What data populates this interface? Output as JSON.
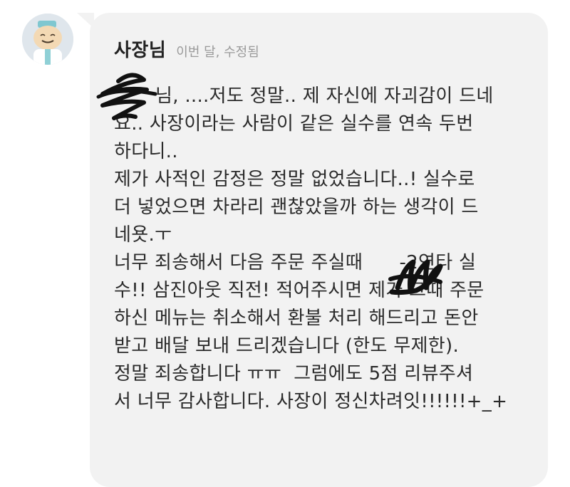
{
  "sender": {
    "name": "사장님",
    "meta": "이번 달, 수정됨"
  },
  "message": {
    "lines": [
      "님, ....저도 정말.. 제 자신에 자괴감이 드네",
      "요.. 사장이라는 사람이 같은 실수를 연속 두번",
      "하다니..",
      "제가 사적인 감정은 정말 없었습니다..! 실수로",
      "더 넣었으면 차라리 괜찮았을까 하는 생각이 드",
      "네욧.ㅜ",
      "너무 죄송해서 다음 주문 주실때      -2연타 실",
      "수!! 삼진아웃 직전! 적어주시면 제가 그때 주문",
      "하신 메뉴는 취소해서 환불 처리 해드리고 돈안",
      "받고 배달 보내 드리겠습니다 (한도 무제한).",
      "정말 죄송합니다 ㅠㅠ  그럼에도 5점 리뷰주셔",
      "서 너무 감사합니다. 사장이 정신차려잇!!!!!!+_+"
    ]
  },
  "colors": {
    "bubble": "#f2f2f2",
    "text": "#2a2a2a",
    "meta": "#9a9a9a"
  }
}
